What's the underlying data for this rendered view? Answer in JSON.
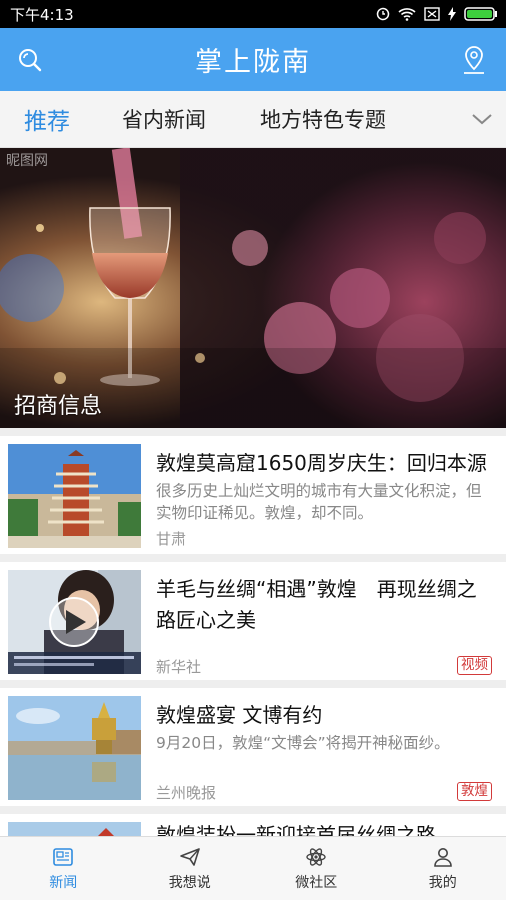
{
  "status_bar": {
    "time": "下午4:13"
  },
  "header": {
    "title": "掌上陇南"
  },
  "tabs": [
    {
      "label": "推荐",
      "active": true
    },
    {
      "label": "省内新闻",
      "active": false
    },
    {
      "label": "地方特色专题",
      "active": false
    }
  ],
  "banner": {
    "caption": "招商信息",
    "watermark": "昵图网"
  },
  "news": [
    {
      "title": "敦煌莫高窟1650周岁庆生：回归本源",
      "desc": "很多历史上灿烂文明的城市有大量文化积淀，但实物印证稀见。敦煌，却不同。",
      "source": "甘肃",
      "tag": ""
    },
    {
      "title": "羊毛与丝绸“相遇”敦煌　再现丝绸之路匠心之美",
      "desc": "",
      "source": "新华社",
      "tag": "视频"
    },
    {
      "title": "敦煌盛宴 文博有约",
      "desc": "9月20日，敦煌“文博会”将揭开神秘面纱。",
      "source": "兰州晚报",
      "tag": "敦煌"
    },
    {
      "title": "敦煌装扮一新迎接首届丝绸之路",
      "desc": "",
      "source": "",
      "tag": ""
    }
  ],
  "bottom_nav": [
    {
      "label": "新闻",
      "icon": "news-icon",
      "active": true
    },
    {
      "label": "我想说",
      "icon": "paper-plane-icon",
      "active": false
    },
    {
      "label": "微社区",
      "icon": "atom-icon",
      "active": false
    },
    {
      "label": "我的",
      "icon": "person-icon",
      "active": false
    }
  ],
  "colors": {
    "primary": "#4aa3f0",
    "active_tab": "#2f8ce0",
    "tag_red": "#d23a3a"
  }
}
